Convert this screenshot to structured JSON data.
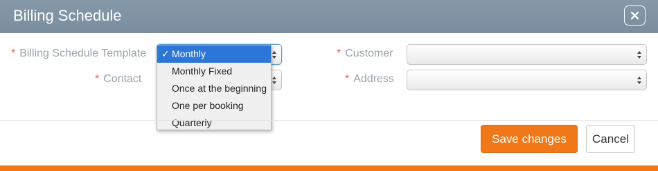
{
  "dialog": {
    "title": "Billing Schedule",
    "close_icon": "close-icon"
  },
  "form": {
    "template": {
      "label": "Billing Schedule Template",
      "required_mark": "*",
      "selected": "Monthly",
      "options": [
        "Monthly",
        "Monthly Fixed",
        "Once at the beginning",
        "One per booking",
        "Quarterly"
      ]
    },
    "contact": {
      "label": "Contact",
      "required_mark": "*",
      "value": ""
    },
    "customer": {
      "label": "Customer",
      "required_mark": "*",
      "value": ""
    },
    "address": {
      "label": "Address",
      "required_mark": "*",
      "value": ""
    }
  },
  "footer": {
    "save_label": "Save changes",
    "cancel_label": "Cancel"
  },
  "colors": {
    "header": "#7f93a4",
    "accent": "#f07818",
    "selection": "#2b76d7",
    "required": "#e55d5d"
  }
}
